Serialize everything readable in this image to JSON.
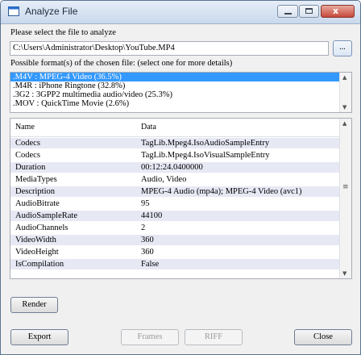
{
  "window": {
    "title": "Analyze File",
    "minimize_label": "",
    "maximize_label": "",
    "close_label": "x"
  },
  "file_select": {
    "label": "Please select the file to analyze",
    "path": "C:\\Users\\Administrator\\Desktop\\YouTube.MP4",
    "browse_label": "..."
  },
  "formats": {
    "label": "Possible format(s) of the chosen file: (select one for more details)",
    "items": [
      ".M4V : MPEG-4 Video (36.5%)",
      ".M4R : iPhone Ringtone (32.8%)",
      ".3G2 : 3GPP2 multimedia audio/video (25.3%)",
      ".MOV : QuickTime Movie (2.6%)"
    ],
    "selected_index": 0
  },
  "details": {
    "columns": [
      "Name",
      "Data"
    ],
    "rows": [
      [
        "Codecs",
        "TagLib.Mpeg4.IsoAudioSampleEntry"
      ],
      [
        "Codecs",
        "TagLib.Mpeg4.IsoVisualSampleEntry"
      ],
      [
        "Duration",
        "00:12:24.0400000"
      ],
      [
        "MediaTypes",
        "Audio, Video"
      ],
      [
        "Description",
        "MPEG-4 Audio (mp4a); MPEG-4 Video (avc1)"
      ],
      [
        "AudioBitrate",
        "95"
      ],
      [
        "AudioSampleRate",
        "44100"
      ],
      [
        "AudioChannels",
        "2"
      ],
      [
        "VideoWidth",
        "360"
      ],
      [
        "VideoHeight",
        "360"
      ],
      [
        "IsCompilation",
        "False"
      ]
    ]
  },
  "buttons": {
    "render": "Render",
    "export": "Export",
    "frames": "Frames",
    "riff": "RIFF",
    "close": "Close"
  }
}
